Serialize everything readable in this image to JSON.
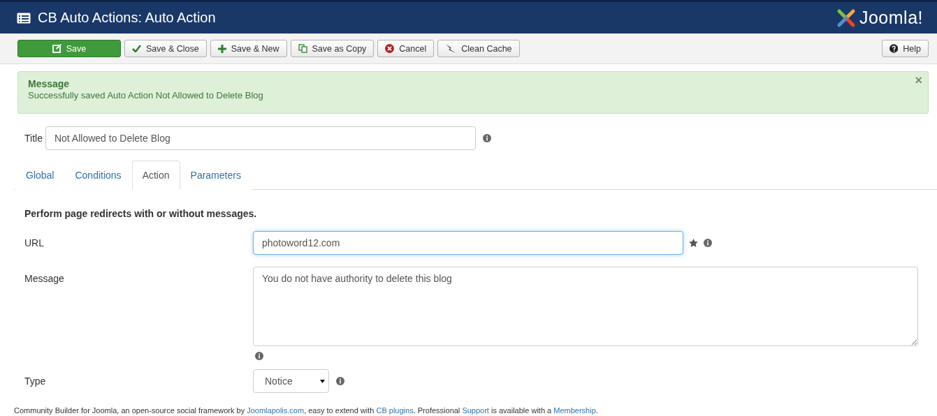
{
  "header": {
    "title": "CB Auto Actions: Auto Action",
    "logo_text": "Joomla!"
  },
  "toolbar": {
    "buttons": [
      {
        "label": "Save",
        "kind": "primary"
      },
      {
        "label": "Save & Close",
        "kind": "default"
      },
      {
        "label": "Save & New",
        "kind": "default"
      },
      {
        "label": "Save as Copy",
        "kind": "default"
      },
      {
        "label": "Cancel",
        "kind": "default"
      },
      {
        "label": "Clean Cache",
        "kind": "default"
      }
    ],
    "help": {
      "label": "Help"
    }
  },
  "message": {
    "heading": "Message",
    "text": "Successfully saved Auto Action Not Allowed to Delete Blog",
    "close": "×"
  },
  "title_field": {
    "label": "Title",
    "value": "Not Allowed to Delete Blog"
  },
  "tabs": [
    {
      "label": "Global",
      "selected": false
    },
    {
      "label": "Conditions",
      "selected": false
    },
    {
      "label": "Action",
      "selected": true
    },
    {
      "label": "Parameters",
      "selected": false
    }
  ],
  "description": "Perform page redirects with or without messages.",
  "fields": [
    {
      "kind": "input",
      "label": "URL",
      "value": "photoword12.com",
      "focused": true,
      "required": true
    },
    {
      "kind": "textarea",
      "label": "Message",
      "value": "You do not have authority to delete this blog",
      "focused": false,
      "required": false
    },
    {
      "kind": "select",
      "label": "Type",
      "value": "Notice",
      "focused": false,
      "required": false
    }
  ],
  "footer": [
    {
      "kind": "text",
      "text": "Community Builder for Joomla, an open-source social framework by "
    },
    {
      "kind": "link",
      "text": "Joomlapolis.com"
    },
    {
      "kind": "text",
      "text": ", easy to extend with "
    },
    {
      "kind": "link",
      "text": "CB plugins"
    },
    {
      "kind": "text",
      "text": ". Professional "
    },
    {
      "kind": "link",
      "text": "Support"
    },
    {
      "kind": "text",
      "text": " is available with a "
    },
    {
      "kind": "link",
      "text": "Membership"
    },
    {
      "kind": "text",
      "text": "."
    }
  ]
}
